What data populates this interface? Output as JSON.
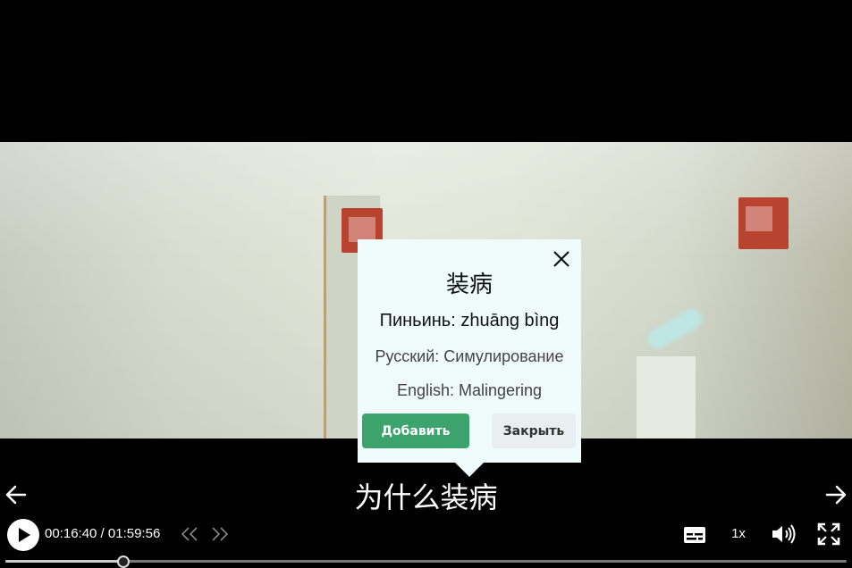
{
  "popup": {
    "close_x": "X",
    "word": "装病",
    "pinyin": "Пиньинь: zhuāng bìng",
    "russian": "Русский: Симулирование",
    "english": "English: Malingering",
    "add_label": "Добавить",
    "close_label": "Закрыть"
  },
  "subtitle": {
    "text": "为什么装病"
  },
  "player": {
    "time_display": "00:16:40 / 01:59:56",
    "speed": "1x",
    "progress_fraction": 0.1389
  },
  "icons": {
    "prev": "arrow-left-icon",
    "next": "arrow-right-icon",
    "play": "play-icon",
    "skip_back": "chevrons-left-icon",
    "skip_fwd": "chevrons-right-icon",
    "subtitles": "subtitles-icon",
    "volume": "volume-icon",
    "fullscreen": "fullscreen-icon"
  },
  "colors": {
    "add_button": "#3da36d",
    "popup_bg": "#effcfb",
    "close_button": "#e9eef0"
  }
}
